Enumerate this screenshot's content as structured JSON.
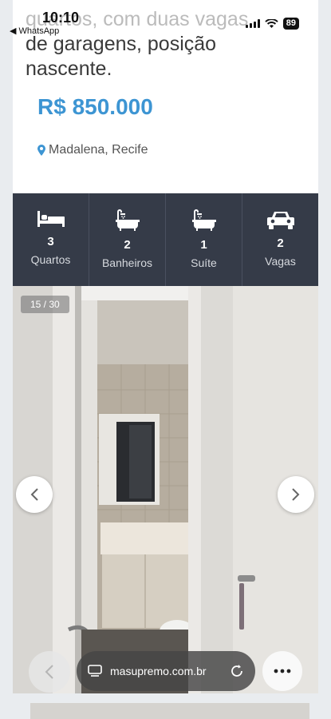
{
  "status_bar": {
    "time": "10:10",
    "back_app": "◀ WhatsApp",
    "battery": "89"
  },
  "listing": {
    "description_top_fade": "quartos, com duas vagas",
    "description": "de garagens, posição nascente.",
    "price": "R$ 850.000",
    "location": "Madalena, Recife"
  },
  "features": [
    {
      "icon": "bed-icon",
      "value": "3",
      "label": "Quartos"
    },
    {
      "icon": "bathtub-icon",
      "value": "2",
      "label": "Banheiros"
    },
    {
      "icon": "bathtub-icon",
      "value": "1",
      "label": "Suíte"
    },
    {
      "icon": "car-icon",
      "value": "2",
      "label": "Vagas"
    }
  ],
  "gallery": {
    "counter": "15 / 30"
  },
  "browser": {
    "url": "masupremo.com.br"
  },
  "colors": {
    "price": "#3d95d3",
    "feature_bar": "#353b48"
  }
}
